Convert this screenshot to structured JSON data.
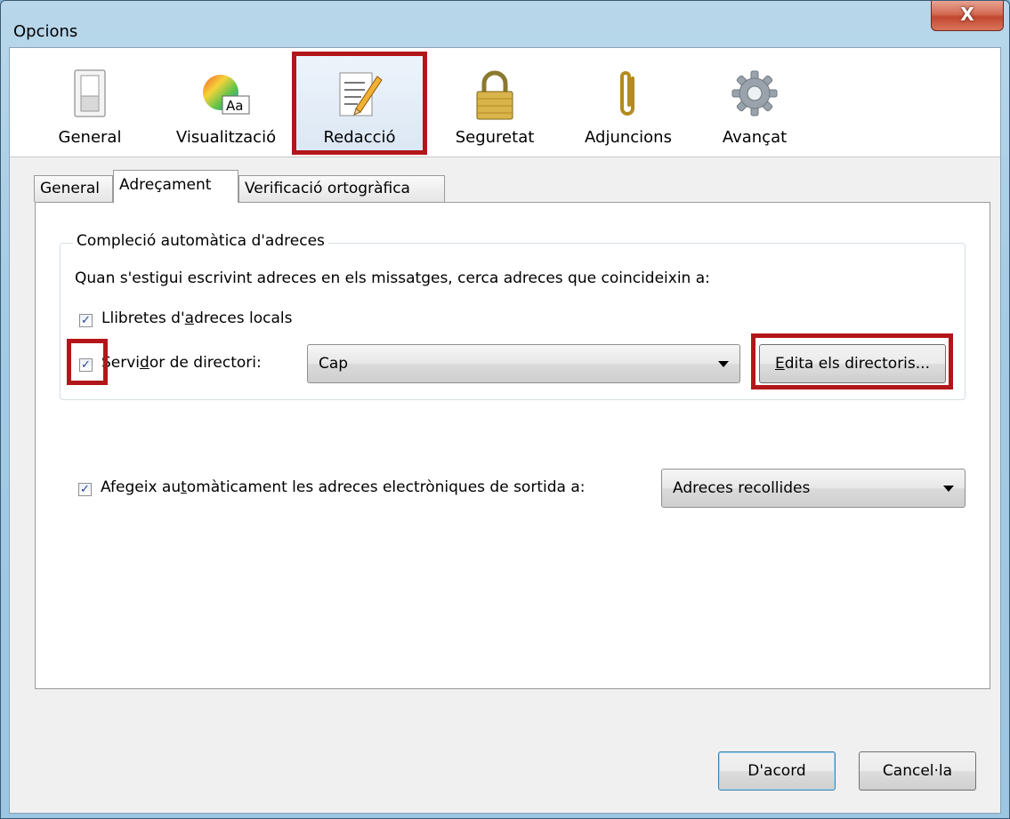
{
  "window": {
    "title": "Opcions",
    "close_glyph": "X"
  },
  "toolbar": {
    "panes": [
      {
        "label": "General",
        "icon": "general-switch-icon"
      },
      {
        "label": "Visualització",
        "icon": "color-display-icon"
      },
      {
        "label": "Redacció",
        "icon": "composition-pencil-icon",
        "selected": true
      },
      {
        "label": "Seguretat",
        "icon": "padlock-icon"
      },
      {
        "label": "Adjuncions",
        "icon": "paperclip-icon"
      },
      {
        "label": "Avançat",
        "icon": "gear-icon"
      }
    ]
  },
  "tabs": [
    {
      "label": "General"
    },
    {
      "label": "Adreçament",
      "active": true
    },
    {
      "label": "Verificació ortogràfica"
    }
  ],
  "addressing": {
    "group_title": "Compleció automàtica d'adreces",
    "description": "Quan s'estigui escrivint adreces en els missatges, cerca adreces que coincideixin a:",
    "local_books": {
      "pre": "Llibretes d'",
      "key": "a",
      "post": "dreces locals",
      "checked": true
    },
    "directory_server": {
      "pre": "Servi",
      "key": "d",
      "post": "or de directori:",
      "checked": true,
      "value": "Cap"
    },
    "edit_directories": {
      "key": "E",
      "post": "dita els directoris..."
    },
    "auto_add": {
      "pre": "Afegeix au",
      "key": "t",
      "post": "omàticament les adreces electròniques de sortida a:",
      "checked": true,
      "value": "Adreces recollides"
    }
  },
  "footer": {
    "ok": "D'acord",
    "cancel": "Cancel·la"
  },
  "colors": {
    "highlight": "#b3161a",
    "check": "#2b3f93"
  }
}
